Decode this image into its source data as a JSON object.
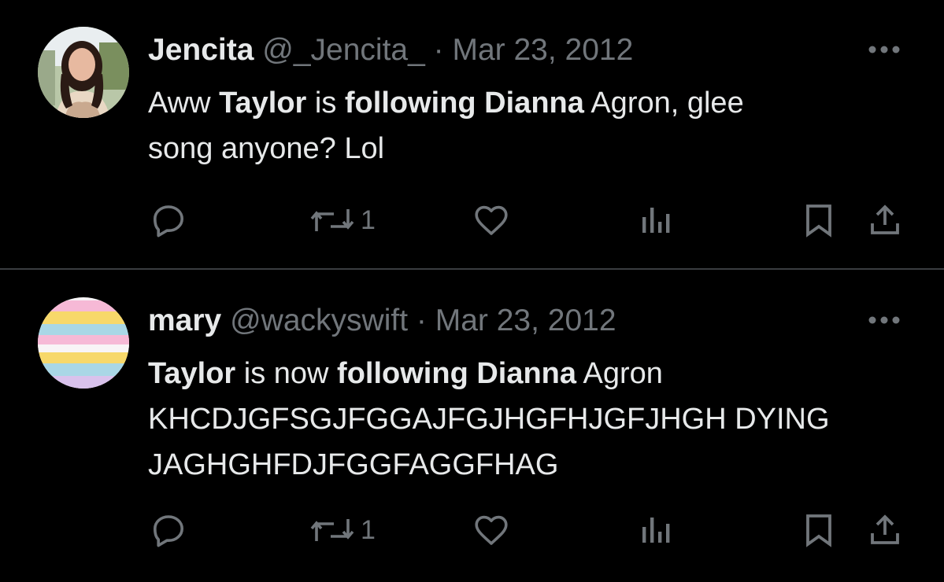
{
  "tweets": [
    {
      "display_name": "Jencita",
      "handle": "@_Jencita_",
      "date": "Mar 23, 2012",
      "text_lines": [
        [
          {
            "t": "Aww ",
            "bold": false
          },
          {
            "t": "Taylor",
            "bold": true
          },
          {
            "t": " is ",
            "bold": false
          },
          {
            "t": "following Dianna",
            "bold": true
          },
          {
            "t": " Agron, glee",
            "bold": false
          }
        ],
        [
          {
            "t": "song anyone? Lol",
            "bold": false
          }
        ]
      ],
      "retweet_count": "1",
      "avatar": "photo-avatar"
    },
    {
      "display_name": "mary",
      "handle": "@wackyswift",
      "date": "Mar 23, 2012",
      "text_lines": [
        [
          {
            "t": "Taylor",
            "bold": true
          },
          {
            "t": " is now ",
            "bold": false
          },
          {
            "t": "following Dianna",
            "bold": true
          },
          {
            "t": " Agron",
            "bold": false
          }
        ],
        [
          {
            "t": "KHCDJGFSGJFGGAJFGJHGFHJGFJHGH DYING",
            "bold": false
          }
        ],
        [
          {
            "t": "JAGHGHFDJFGGFAGGFHAG",
            "bold": false
          }
        ]
      ],
      "retweet_count": "1",
      "avatar": "pastel-stripes-avatar"
    }
  ],
  "separator": " · ",
  "icons": {
    "reply": "reply-icon",
    "retweet": "retweet-icon",
    "like": "heart-icon",
    "views": "views-chart-icon",
    "bookmark": "bookmark-icon",
    "share": "share-icon",
    "more": "more-dots-icon"
  },
  "colors": {
    "background": "#000000",
    "text": "#e7e9ea",
    "muted": "#71767b",
    "divider": "#3a3d40"
  }
}
